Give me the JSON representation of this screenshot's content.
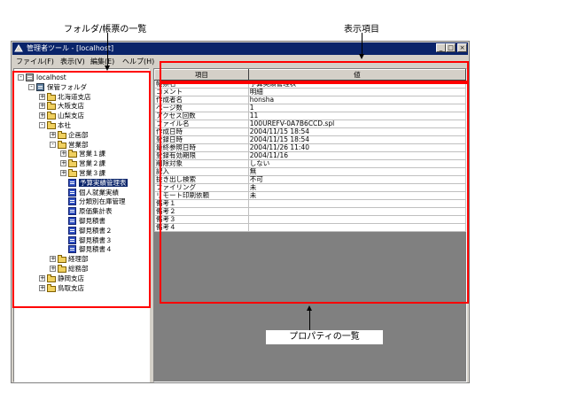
{
  "annotations": {
    "tree_label": "フォルダ/帳票の一覧",
    "columns_label": "表示項目",
    "property_label": "プロパティの一覧"
  },
  "window": {
    "title": "管理者ツール - [localhost]",
    "controls": {
      "minimize": "_",
      "maximize": "□",
      "close": "×"
    }
  },
  "menu": [
    "ファイル(F)",
    "表示(V)",
    "編集(E)",
    "ヘルプ(H)"
  ],
  "tree": [
    {
      "label": "localhost",
      "exp": "-",
      "icon": "computer",
      "depth": 0
    },
    {
      "label": "保管フォルダ",
      "exp": "-",
      "icon": "cabinet",
      "depth": 1
    },
    {
      "label": "北海道支店",
      "exp": "+",
      "icon": "folder",
      "depth": 2
    },
    {
      "label": "大阪支店",
      "exp": "+",
      "icon": "folder",
      "depth": 2
    },
    {
      "label": "山梨支店",
      "exp": "+",
      "icon": "folder",
      "depth": 2
    },
    {
      "label": "本社",
      "exp": "-",
      "icon": "folder",
      "depth": 2
    },
    {
      "label": "企画部",
      "exp": "+",
      "icon": "folder",
      "depth": 3
    },
    {
      "label": "営業部",
      "exp": "-",
      "icon": "folder",
      "depth": 3
    },
    {
      "label": "営業１課",
      "exp": "+",
      "icon": "folder",
      "depth": 4
    },
    {
      "label": "営業２課",
      "exp": "+",
      "icon": "folder",
      "depth": 4
    },
    {
      "label": "営業３課",
      "exp": "+",
      "icon": "folder",
      "depth": 4
    },
    {
      "label": "予算実績管理表",
      "exp": "",
      "icon": "doc",
      "depth": 4,
      "selected": true
    },
    {
      "label": "個人就業実績",
      "exp": "",
      "icon": "doc",
      "depth": 4
    },
    {
      "label": "分類別在庫管理",
      "exp": "",
      "icon": "doc",
      "depth": 4
    },
    {
      "label": "原価集計表",
      "exp": "",
      "icon": "doc",
      "depth": 4
    },
    {
      "label": "御見積書",
      "exp": "",
      "icon": "doc",
      "depth": 4
    },
    {
      "label": "御見積書２",
      "exp": "",
      "icon": "doc",
      "depth": 4
    },
    {
      "label": "御見積書３",
      "exp": "",
      "icon": "doc",
      "depth": 4
    },
    {
      "label": "御見積書４",
      "exp": "",
      "icon": "doc",
      "depth": 4
    },
    {
      "label": "経理部",
      "exp": "+",
      "icon": "folder",
      "depth": 3
    },
    {
      "label": "総務部",
      "exp": "+",
      "icon": "folder",
      "depth": 3
    },
    {
      "label": "静岡支店",
      "exp": "+",
      "icon": "folder",
      "depth": 2
    },
    {
      "label": "鳥取支店",
      "exp": "+",
      "icon": "folder",
      "depth": 2
    }
  ],
  "properties": {
    "headers": [
      "項目",
      "値"
    ],
    "rows": [
      [
        "帳票名",
        "予算実績管理表"
      ],
      [
        "コメント",
        "明細"
      ],
      [
        "作成者名",
        "honsha"
      ],
      [
        "ページ数",
        "1"
      ],
      [
        "アクセス回数",
        "11"
      ],
      [
        "ファイル名",
        "100UREFV-0A7B6CCD.spl"
      ],
      [
        "作成日時",
        "2004/11/15 18:54"
      ],
      [
        "登録日時",
        "2004/11/15 18:54"
      ],
      [
        "最終参照日時",
        "2004/11/26 11:40"
      ],
      [
        "登録有効期限",
        "2004/11/16"
      ],
      [
        "削除対象",
        "しない"
      ],
      [
        "記入",
        "無"
      ],
      [
        "抜き出し検索",
        "不可"
      ],
      [
        "ファイリング",
        "未"
      ],
      [
        "リモート印刷依頼",
        "未"
      ],
      [
        "備考１",
        ""
      ],
      [
        "備考２",
        ""
      ],
      [
        "備考３",
        ""
      ],
      [
        "備考４",
        ""
      ]
    ]
  },
  "colors": {
    "titlebar": "#0a246a",
    "highlight": "#ff0000",
    "face": "#d4d0c8"
  }
}
